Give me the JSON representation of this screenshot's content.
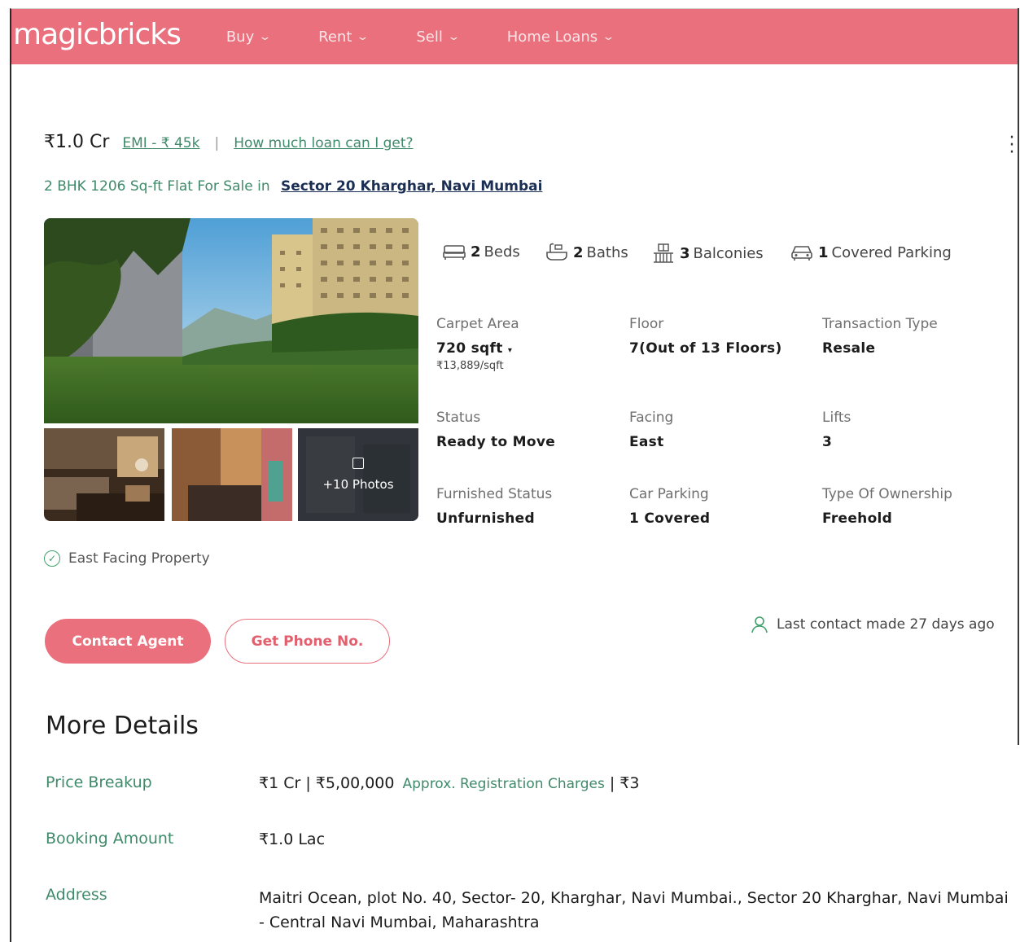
{
  "header": {
    "logo": "magicbricks",
    "nav": [
      {
        "label": "Buy"
      },
      {
        "label": "Rent"
      },
      {
        "label": "Sell"
      },
      {
        "label": "Home Loans"
      }
    ]
  },
  "listing": {
    "price": "₹1.0 Cr",
    "emi": "EMI - ₹ 45k",
    "separator": "|",
    "loan_link": "How much loan can I get?",
    "subtitle": "2 BHK 1206 Sq-ft Flat For Sale in",
    "location": "Sector 20 Kharghar, Navi Mumbai",
    "more_photos": "+10 Photos",
    "amenities": {
      "beds_count": "2",
      "beds_label": "Beds",
      "baths_count": "2",
      "baths_label": "Baths",
      "balconies_count": "3",
      "balconies_label": "Balconies",
      "parking_count": "1",
      "parking_label": "Covered Parking"
    },
    "facts": {
      "carpet_area_label": "Carpet Area",
      "carpet_area_value": "720 sqft",
      "price_per_sqft": "₹13,889/sqft",
      "floor_label": "Floor",
      "floor_value": "7(Out of 13 Floors)",
      "transaction_label": "Transaction Type",
      "transaction_value": "Resale",
      "status_label": "Status",
      "status_value": "Ready to Move",
      "facing_label": "Facing",
      "facing_value": "East",
      "lifts_label": "Lifts",
      "lifts_value": "3",
      "furnished_label": "Furnished Status",
      "furnished_value": "Unfurnished",
      "car_parking_label": "Car Parking",
      "car_parking_value": "1 Covered",
      "ownership_label": "Type Of Ownership",
      "ownership_value": "Freehold"
    },
    "highlight": "East Facing Property",
    "contact_button": "Contact Agent",
    "phone_button": "Get Phone No.",
    "last_contact": "Last contact made 27 days ago"
  },
  "more_details": {
    "title": "More Details",
    "price_breakup_label": "Price Breakup",
    "price_breakup_value": "₹1 Cr | ₹5,00,000",
    "price_breakup_note": "Approx. Registration Charges",
    "price_breakup_tail": "| ₹3",
    "booking_label": "Booking Amount",
    "booking_value": "₹1.0 Lac",
    "address_label": "Address",
    "address_value": "Maitri Ocean, plot No. 40, Sector- 20, Kharghar, Navi Mumbai., Sector 20 Kharghar, Navi Mumbai - Central Navi Mumbai, Maharashtra"
  },
  "colors": {
    "brand": "#e9707c",
    "link_green": "#3f8a6a",
    "location_navy": "#1b2f55"
  },
  "icons": [
    "bed-icon",
    "bath-icon",
    "balcony-icon",
    "car-icon",
    "check-circle-icon",
    "user-icon",
    "kebab-menu-icon",
    "photo-icon",
    "chevron-down-icon"
  ]
}
